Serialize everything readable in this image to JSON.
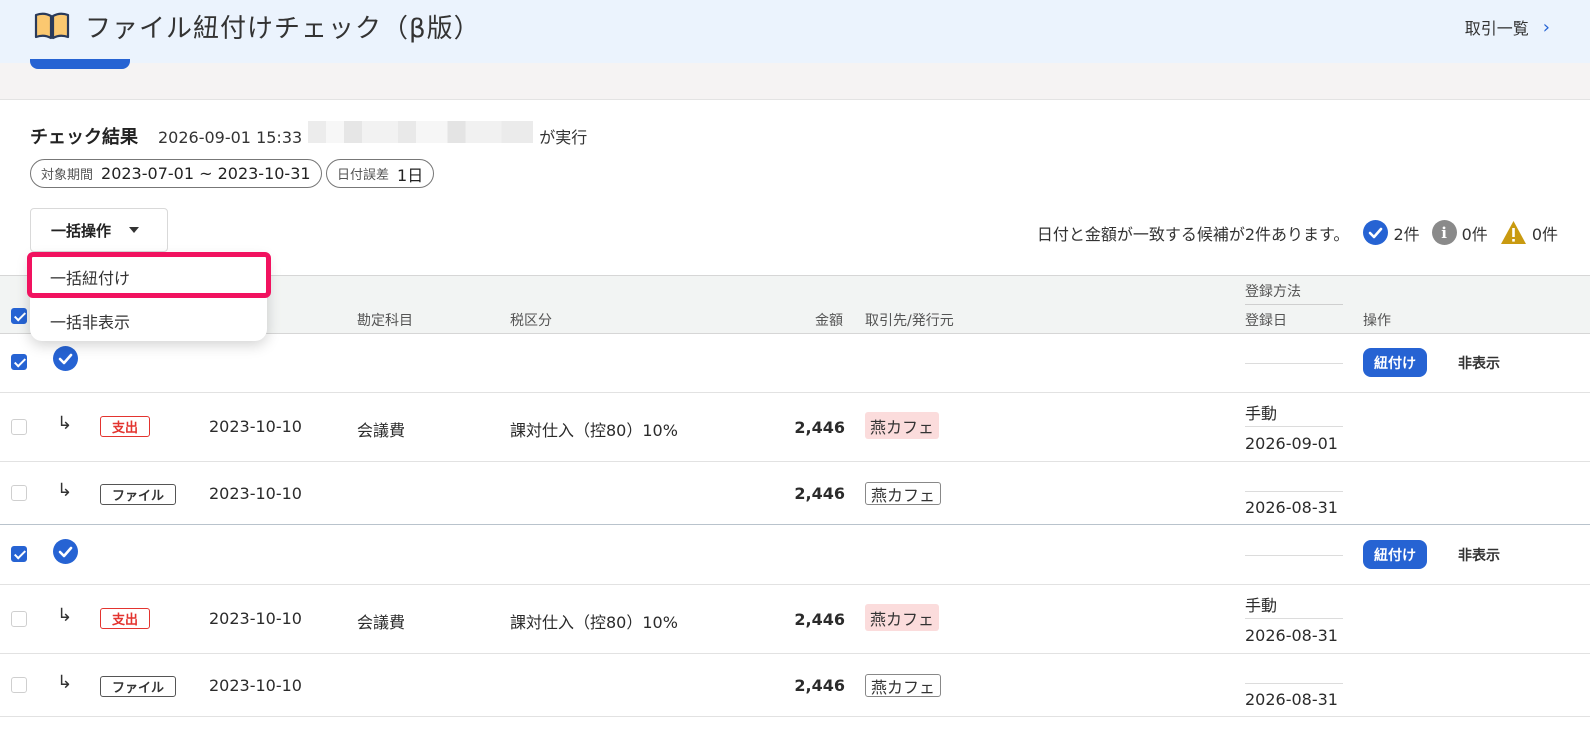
{
  "header": {
    "title": "ファイル紐付けチェック（β版）",
    "nav_link": "取引一覧"
  },
  "result": {
    "title": "チェック結果",
    "timestamp": "2026-09-01 15:33",
    "executed_suffix": "が実行"
  },
  "filters": {
    "period_label": "対象期間",
    "period_value": "2023-07-01 ~ 2023-10-31",
    "tolerance_label": "日付誤差",
    "tolerance_value": "1日"
  },
  "bulk": {
    "button_label": "一括操作",
    "menu": [
      "一括紐付け",
      "一括非表示"
    ]
  },
  "stats": {
    "message": "日付と金額が一致する候補が2件あります。",
    "ok_count": "2件",
    "info_count": "0件",
    "warn_count": "0件"
  },
  "table": {
    "headers": {
      "account": "勘定科目",
      "tax": "税区分",
      "amount": "金額",
      "partner": "取引先/発行元",
      "reg_method": "登録方法",
      "reg_date": "登録日",
      "action": "操作"
    },
    "link_label": "紐付け",
    "hide_label": "非表示",
    "groups": [
      {
        "expense": {
          "tag": "支出",
          "date": "2023-10-10",
          "account": "会議費",
          "tax": "課対仕入（控80）10%",
          "amount": "2,446",
          "partner": "燕カフェ",
          "reg_method": "手動",
          "reg_date": "2026-09-01"
        },
        "file": {
          "tag": "ファイル",
          "date": "2023-10-10",
          "amount": "2,446",
          "partner": "燕カフェ",
          "reg_date": "2026-08-31"
        }
      },
      {
        "expense": {
          "tag": "支出",
          "date": "2023-10-10",
          "account": "会議費",
          "tax": "課対仕入（控80）10%",
          "amount": "2,446",
          "partner": "燕カフェ",
          "reg_method": "手動",
          "reg_date": "2026-08-31"
        },
        "file": {
          "tag": "ファイル",
          "date": "2023-10-10",
          "amount": "2,446",
          "partner": "燕カフェ",
          "reg_date": "2026-08-31"
        }
      }
    ]
  },
  "colors": {
    "accent": "#2663d3",
    "highlight": "#f1125f",
    "expense": "#e3342f",
    "partner_bg": "#fbdcdc",
    "header_bg": "#ebf3fd"
  }
}
